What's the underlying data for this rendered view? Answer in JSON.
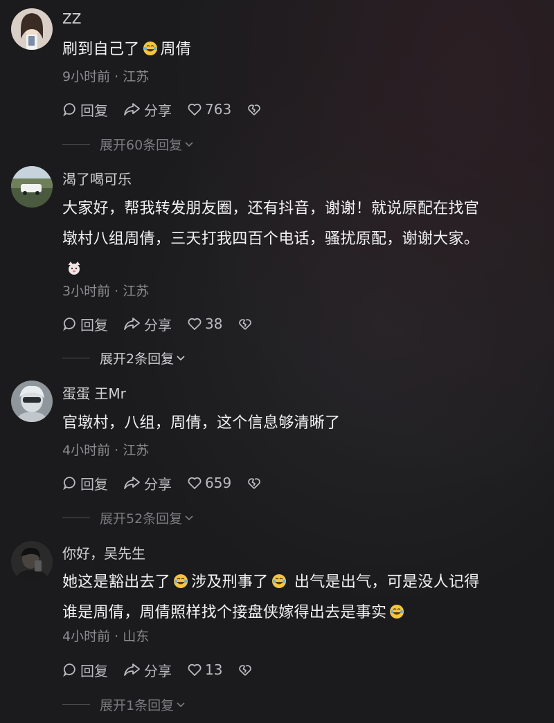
{
  "comments": [
    {
      "username": "ZZ",
      "text_parts": [
        "刷到自己了",
        "周倩"
      ],
      "meta": "9小时前 · 江苏",
      "reply": "回复",
      "share": "分享",
      "likes": "763",
      "expand": "展开60条回复"
    },
    {
      "username": "渴了喝可乐",
      "text_lines": [
        "大家好，帮我转发朋友圈，还有抖音，谢谢！就说原配在找官",
        "墩村八组周倩，三天打我四百个电话，骚扰原配，谢谢大家。"
      ],
      "meta": "3小时前 · 江苏",
      "reply": "回复",
      "share": "分享",
      "likes": "38",
      "expand": "展开2条回复"
    },
    {
      "username": "蛋蛋 王Mr",
      "text": "官墩村，八组，周倩，这个信息够清晰了",
      "meta": "4小时前 · 江苏",
      "reply": "回复",
      "share": "分享",
      "likes": "659",
      "expand": "展开52条回复"
    },
    {
      "username": "你好，吴先生",
      "text_parts": [
        "她这是豁出去了",
        "涉及刑事了",
        "出气是出气，可是没人记得",
        "谁是周倩，周倩照样找个接盘侠嫁得出去是事实"
      ],
      "meta": "4小时前 · 山东",
      "reply": "回复",
      "share": "分享",
      "likes": "13",
      "expand": "展开1条回复"
    }
  ],
  "colors": {
    "background": "#1b1b1d",
    "text": "#f2f2f4",
    "secondary": "#8c8c90",
    "emoji_face": "#f5c542"
  }
}
